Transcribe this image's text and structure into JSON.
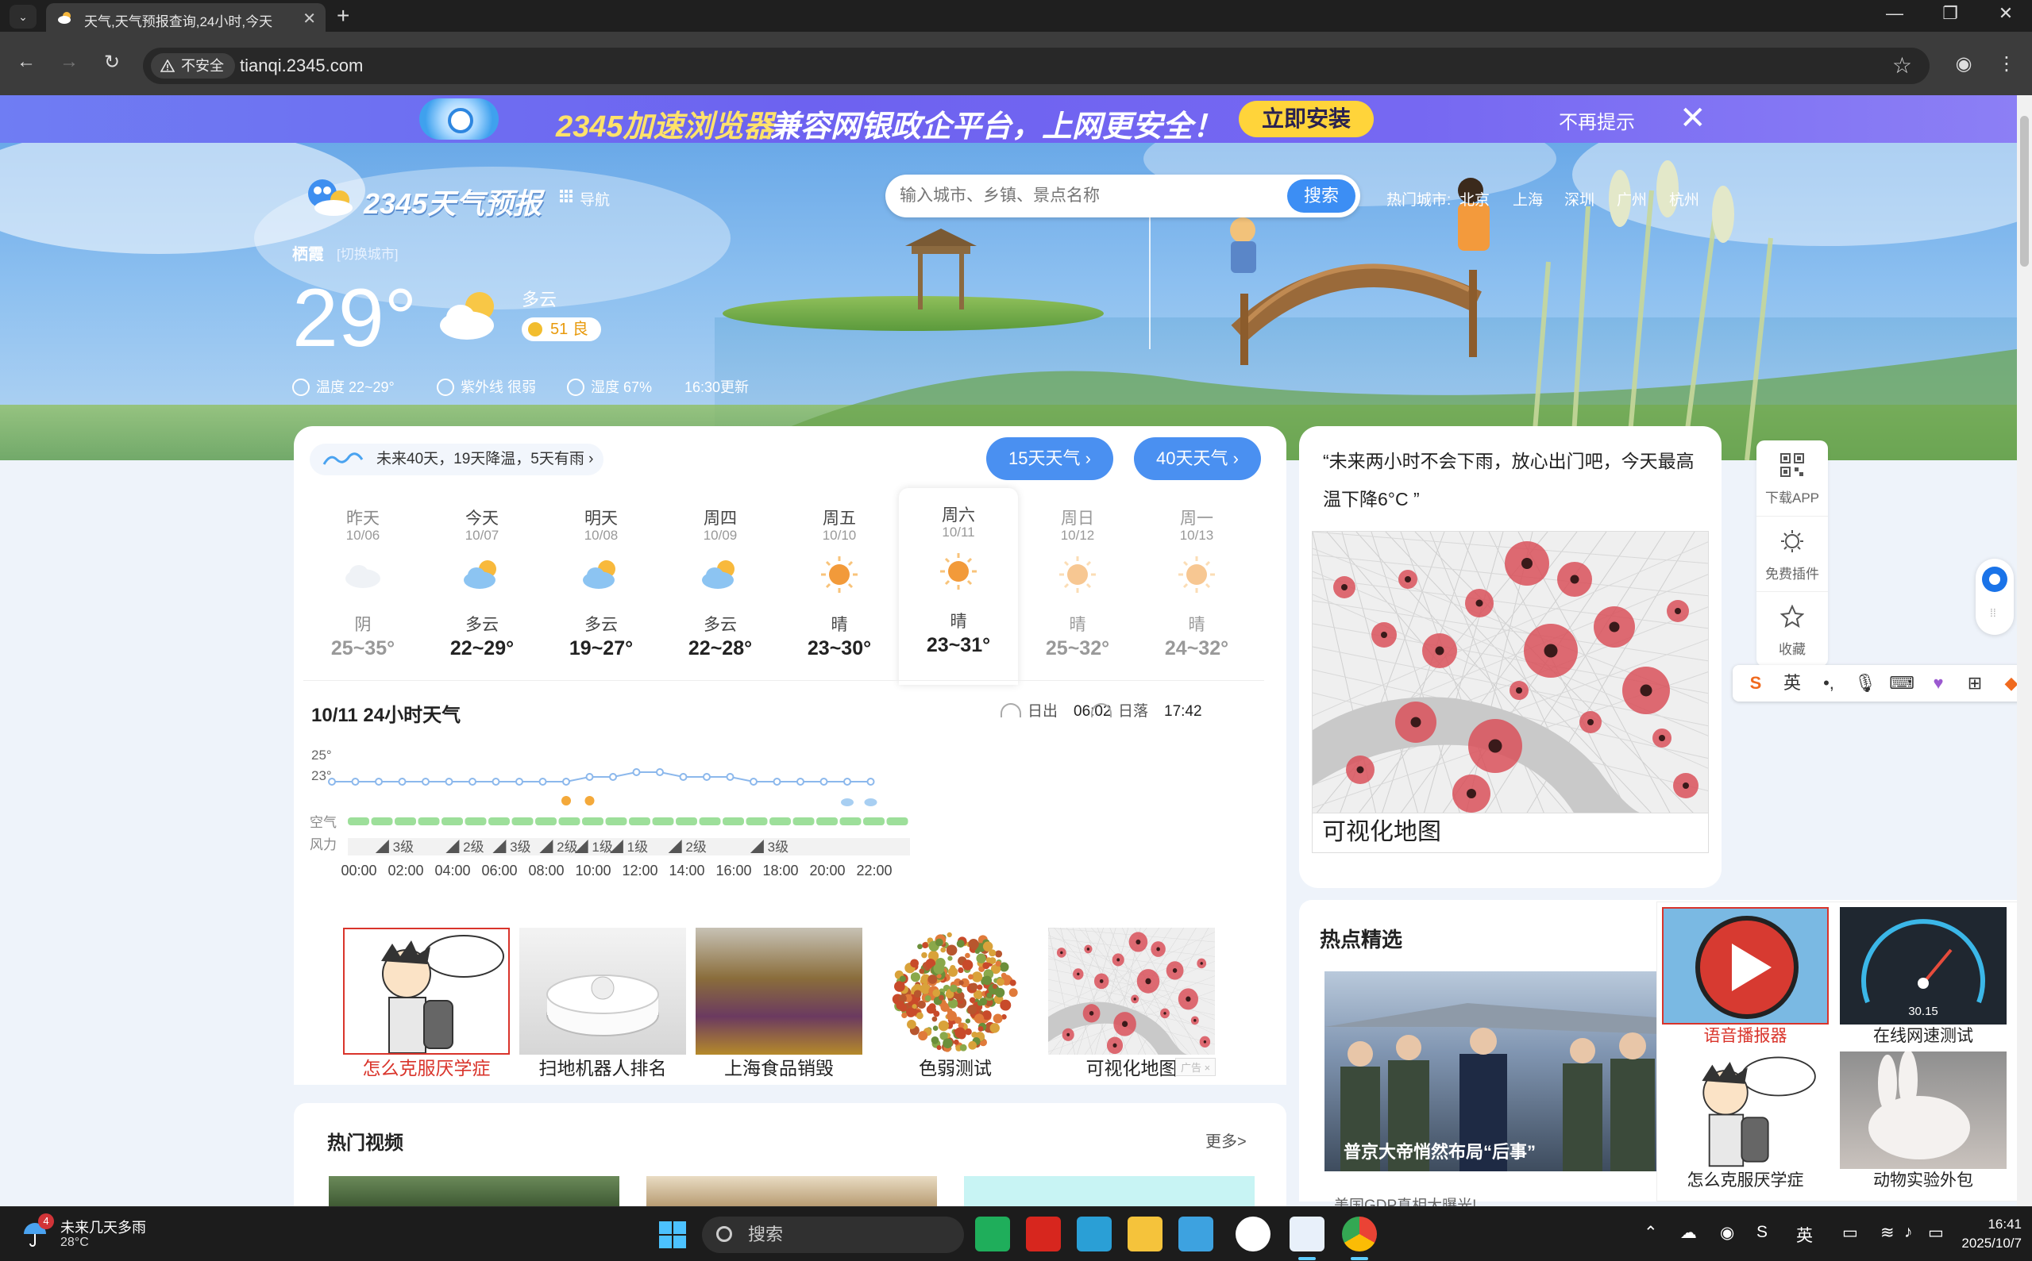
{
  "browser": {
    "tab_title": "天气,天气预报查询,24小时,今天",
    "security_label": "不安全",
    "url": "tianqi.2345.com"
  },
  "promo": {
    "brand": "2345加速浏览器",
    "text": "兼容网银政企平台，上网更安全！",
    "install": "立即安装",
    "dismiss": "不再提示"
  },
  "header": {
    "logo_text": "2345天气预报",
    "nav_label": "导航",
    "search_placeholder": "输入城市、乡镇、景点名称",
    "search_button": "搜索",
    "hot_label": "热门城市:",
    "hot_cities": [
      "北京",
      "上海",
      "深圳",
      "广州",
      "杭州"
    ]
  },
  "current": {
    "city": "栖霞",
    "switch_city": "[切换城市]",
    "temp": "29°",
    "condition": "多云",
    "aqi_value": "51",
    "aqi_level": "良",
    "temp_range": "温度 22~29°",
    "uv": "紫外线 很弱",
    "humidity": "湿度 67%",
    "update": "16:30更新"
  },
  "forecast": {
    "trend_text": "未来40天，19天降温，5天有雨",
    "btn_15": "15天天气",
    "btn_40": "40天天气",
    "days": [
      {
        "name": "昨天",
        "date": "10/06",
        "cond": "阴",
        "temp": "25~35°",
        "icon": "overcast-icon"
      },
      {
        "name": "今天",
        "date": "10/07",
        "cond": "多云",
        "temp": "22~29°",
        "icon": "partly-cloudy-icon"
      },
      {
        "name": "明天",
        "date": "10/08",
        "cond": "多云",
        "temp": "19~27°",
        "icon": "partly-cloudy-icon"
      },
      {
        "name": "周四",
        "date": "10/09",
        "cond": "多云",
        "temp": "22~28°",
        "icon": "partly-cloudy-icon"
      },
      {
        "name": "周五",
        "date": "10/10",
        "cond": "晴",
        "temp": "23~30°",
        "icon": "sunny-icon"
      },
      {
        "name": "周六",
        "date": "10/11",
        "cond": "晴",
        "temp": "23~31°",
        "icon": "sunny-icon"
      },
      {
        "name": "周日",
        "date": "10/12",
        "cond": "晴",
        "temp": "25~32°",
        "icon": "sunny-icon"
      },
      {
        "name": "周一",
        "date": "10/13",
        "cond": "晴",
        "temp": "24~32°",
        "icon": "sunny-icon"
      }
    ]
  },
  "hourly": {
    "title": "10/11 24小时天气",
    "sunrise_label": "日出",
    "sunrise": "06:02",
    "sunset_label": "日落",
    "sunset": "17:42",
    "air_label": "空气",
    "wind_label": "风力",
    "y_labels": [
      "25°",
      "23°"
    ],
    "x_labels": [
      "00:00",
      "02:00",
      "04:00",
      "06:00",
      "08:00",
      "10:00",
      "12:00",
      "14:00",
      "16:00",
      "18:00",
      "20:00",
      "22:00"
    ],
    "wind_segments": [
      {
        "label": "3级",
        "from": 0,
        "to": 3
      },
      {
        "label": "2级",
        "from": 4,
        "to": 5
      },
      {
        "label": "3级",
        "from": 6,
        "to": 7
      },
      {
        "label": "2级",
        "from": 8,
        "to": 9
      },
      {
        "label": "1级",
        "from": 10,
        "to": 10
      },
      {
        "label": "1级",
        "from": 11,
        "to": 12
      },
      {
        "label": "2级",
        "from": 13,
        "to": 15
      },
      {
        "label": "3级",
        "from": 16,
        "to": 19
      }
    ],
    "air_color": "#9ddf9a"
  },
  "thumbnails": [
    {
      "caption": "怎么克服厌学症",
      "red": true
    },
    {
      "caption": "扫地机器人排名",
      "red": false
    },
    {
      "caption": "上海食品销毁",
      "red": false
    },
    {
      "caption": "色弱测试",
      "red": false
    },
    {
      "caption": "可视化地图",
      "red": false
    }
  ],
  "ad_tag": "广告 ×",
  "hot_video": {
    "title": "热门视频",
    "more": "更多>"
  },
  "right": {
    "quote": "“未来两小时不会下雨，放心出门吧，今天最高温下降6°C ”",
    "map_caption": "可视化地图",
    "hot_title": "热点精选",
    "news_caption": "普京大帝悄然布局“后事”",
    "news_next": "美国GDP真相大曝光!"
  },
  "side_tools": [
    {
      "label": "下载APP",
      "icon": "qr-code-icon"
    },
    {
      "label": "免费插件",
      "icon": "sun-plugin-icon"
    },
    {
      "label": "收藏",
      "icon": "star-icon"
    }
  ],
  "ime": {
    "lang": "英"
  },
  "ads": [
    {
      "caption": "语音播报器",
      "red": true
    },
    {
      "caption": "在线网速测试",
      "red": false
    },
    {
      "caption": "怎么克服厌学症",
      "red": false
    },
    {
      "caption": "动物实验外包",
      "red": false
    }
  ],
  "speedtest": {
    "value": "30.15"
  },
  "taskbar": {
    "weather_title": "未来几天多雨",
    "weather_temp": "28°C",
    "badge": "4",
    "search": "搜索",
    "ime": "英",
    "time": "16:41",
    "date": "2025/10/7"
  },
  "colors": {
    "accent": "#4a90f1",
    "promo_yellow": "#ffd43a",
    "line": "#8cb8ec"
  }
}
